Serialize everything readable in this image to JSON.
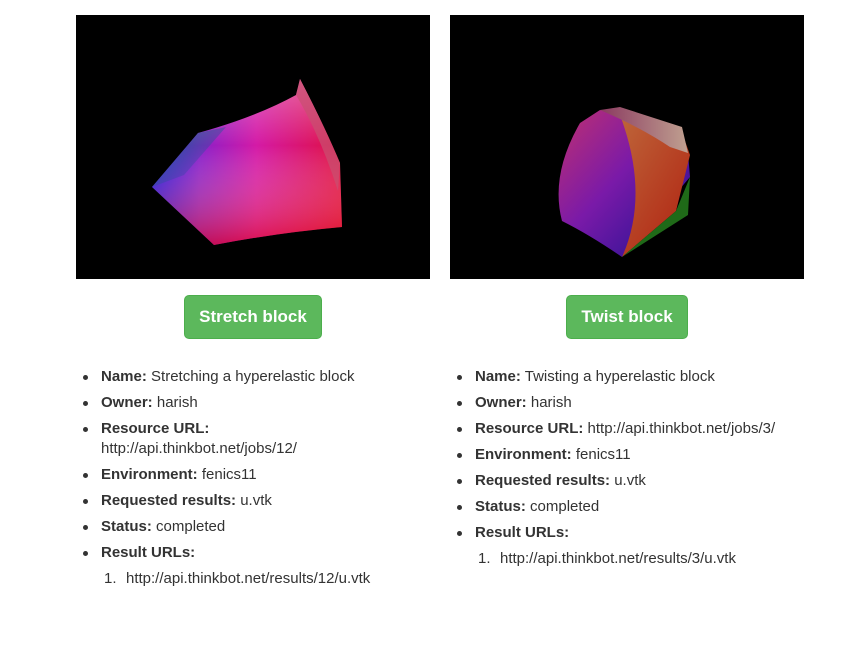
{
  "jobs": [
    {
      "button_label": "Stretch block",
      "name_label": "Name:",
      "name": "Stretching a hyperelastic block",
      "owner_label": "Owner:",
      "owner": "harish",
      "resource_label": "Resource URL:",
      "resource_url": "http://api.thinkbot.net/jobs/12/",
      "environment_label": "Environment:",
      "environment": "fenics11",
      "requested_label": "Requested results:",
      "requested": "u.vtk",
      "status_label": "Status:",
      "status": "completed",
      "results_label": "Result URLs:",
      "results": [
        {
          "num": "1.",
          "url": "http://api.thinkbot.net/results/12/u.vtk"
        }
      ]
    },
    {
      "button_label": "Twist block",
      "name_label": "Name:",
      "name": "Twisting a hyperelastic block",
      "owner_label": "Owner:",
      "owner": "harish",
      "resource_label": "Resource URL:",
      "resource_url": "http://api.thinkbot.net/jobs/3/",
      "environment_label": "Environment:",
      "environment": "fenics11",
      "requested_label": "Requested results:",
      "requested": "u.vtk",
      "status_label": "Status:",
      "status": "completed",
      "results_label": "Result URLs:",
      "results": [
        {
          "num": "1.",
          "url": "http://api.thinkbot.net/results/3/u.vtk"
        }
      ]
    }
  ],
  "colors": {
    "button": "#5cb85c",
    "viewer_background": "#000000",
    "text": "#333333"
  }
}
